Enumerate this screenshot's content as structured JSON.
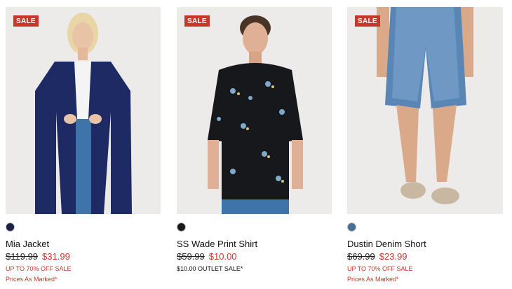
{
  "badge_label": "SALE",
  "products": [
    {
      "name": "Mia Jacket",
      "old_price": "$119.99",
      "new_price": "$31.99",
      "promo": "UP TO 70% OFF SALE",
      "note": "Prices As Marked*",
      "swatch_color": "#1c2244",
      "image_icon": "woman-navy-coat"
    },
    {
      "name": "SS Wade Print Shirt",
      "old_price": "$59.99",
      "new_price": "$10.00",
      "promo": "$10.00 OUTLET SALE*",
      "swatch_color": "#1a1a1a",
      "image_icon": "man-floral-shirt"
    },
    {
      "name": "Dustin Denim Short",
      "old_price": "$69.99",
      "new_price": "$23.99",
      "promo": "UP TO 70% OFF SALE",
      "note": "Prices As Marked*",
      "swatch_color": "#4a6f96",
      "image_icon": "denim-shorts-legs"
    }
  ],
  "colors": {
    "sale": "#c8382a",
    "image_bg": "#ecebea"
  }
}
